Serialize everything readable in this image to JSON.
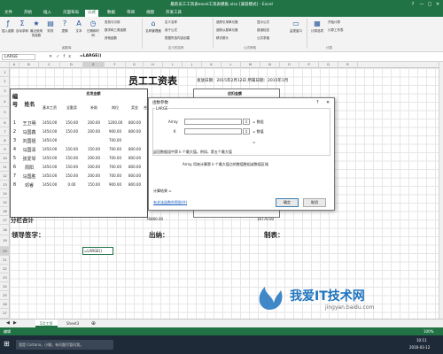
{
  "window": {
    "title": "最新员工工资表excel工资表模板.xlsx [兼容模式] - Excel",
    "controls": [
      "?",
      "—",
      "□",
      "✕"
    ]
  },
  "tabs": [
    "文件",
    "开始",
    "插入",
    "页面布局",
    "公式",
    "数据",
    "审阅",
    "视图",
    "开发工具"
  ],
  "ribbon": {
    "buttons": [
      "插入函数",
      "自动求和",
      "最近使用的函数",
      "财务",
      "逻辑",
      "文本",
      "日期和时间",
      "查找与引用",
      "数学和三角函数",
      "其他函数",
      "名称管理器"
    ],
    "name_items": [
      "定义名称",
      "用于公式",
      "根据所选内容创建"
    ],
    "audit_items": [
      "追踪引用单元格",
      "追踪从属单元格",
      "移去箭头",
      "显示公式",
      "错误检查",
      "公式求值",
      "监视窗口"
    ],
    "calc_items": [
      "计算选项",
      "开始计算",
      "计算工作表"
    ],
    "groups": [
      "函数库",
      "定义的名称",
      "公式审核",
      "计算"
    ]
  },
  "formula_bar": {
    "name_box": "LARGE",
    "icons": [
      "✕",
      "✓",
      "fx"
    ],
    "formula": "=LARGE()"
  },
  "columns": [
    "A",
    "B",
    "C",
    "D",
    "E",
    "F",
    "G",
    "H",
    "I",
    "J",
    "K",
    "L",
    "M",
    "N",
    "O",
    "P",
    "Q",
    "R"
  ],
  "rows": [
    "1",
    "2",
    "3",
    "4",
    "5",
    "6",
    "7",
    "8",
    "9",
    "10",
    "11",
    "12",
    "13",
    "14",
    "15",
    "16",
    "17",
    "18",
    "19",
    "20",
    "21",
    "22",
    "23",
    "24",
    "25",
    "26",
    "27",
    "28",
    "29",
    "30",
    "31"
  ],
  "sheet": {
    "title": "员工工资表",
    "issue_date": "发放日期：2015年2月12日  所属日期：2015年1月",
    "header_num": "编号",
    "header_name": "姓名",
    "group_payable": "应发金额",
    "group_deduct": "应扣金额",
    "subheaders": [
      "基本工资",
      "全勤奖",
      "补助",
      "岗位",
      "奖金",
      "合"
    ],
    "employees": [
      {
        "no": "1",
        "name": "王卫明",
        "vals": [
          "1450.00",
          "150.00",
          "200.00",
          "1200.00",
          "800.00"
        ]
      },
      {
        "no": "2",
        "name": "马国鑫",
        "vals": [
          "1450.00",
          "150.00",
          "200.00",
          "900.00",
          "800.00"
        ]
      },
      {
        "no": "3",
        "name": "刘国祖",
        "vals": [
          "1450.00",
          "",
          "",
          "700.00",
          ""
        ]
      },
      {
        "no": "4",
        "name": "马国清",
        "vals": [
          "1450.00",
          "150.00",
          "150.00",
          "700.00",
          "800.00"
        ]
      },
      {
        "no": "5",
        "name": "张爱琴",
        "vals": [
          "1450.00",
          "150.00",
          "200.00",
          "700.00",
          "800.00"
        ]
      },
      {
        "no": "6",
        "name": "周阳",
        "vals": [
          "1450.00",
          "150.00",
          "200.00",
          "700.00",
          "800.00"
        ]
      },
      {
        "no": "7",
        "name": "马国胜",
        "vals": [
          "1450.00",
          "150.00",
          "200.00",
          "700.00",
          "800.00"
        ]
      },
      {
        "no": "8",
        "name": "邓睿",
        "vals": [
          "1450.00",
          "0.00",
          "150.00",
          "900.00",
          "800.00"
        ]
      }
    ],
    "subtotal_label": "分栏合计",
    "subtotal_1": "76800.00",
    "subtotal_2": "16770.00",
    "sign_leader": "领导签字：",
    "sign_cashier": "出纳：",
    "sign_maker": "制表：",
    "active_cell": "=LARGE()"
  },
  "dialog": {
    "title": "函数参数",
    "func": "LARGE",
    "arg1": "Array",
    "arg2": "K",
    "arg_value": "= 数组",
    "arg_value2": "= 数值",
    "result_eq": "=",
    "desc": "返回数据组中第 k 个最大值。例如，第五个最大值",
    "arg_desc": "Array  用来计算第 k 个最大值点的数值数组或数值区域",
    "result": "计算结果 =",
    "help": "有关该函数的帮助(H)",
    "ok": "确定",
    "cancel": "取消",
    "help_btn": "?",
    "close": "✕"
  },
  "sheet_tabs": [
    "5月工资",
    "Sheet3"
  ],
  "statusbar": {
    "mode": "编辑",
    "zoom": "100%"
  },
  "taskbar": {
    "search": "我是 Cortana，小娜。有问题尽管问我。",
    "time": "10:11",
    "date": "2016-03-12"
  },
  "watermark": {
    "text": "我爱IT技术网",
    "url": "jingyan.baidu.com"
  },
  "colors": {
    "excel_green": "#217346",
    "watermark_blue": "#1e73be"
  }
}
